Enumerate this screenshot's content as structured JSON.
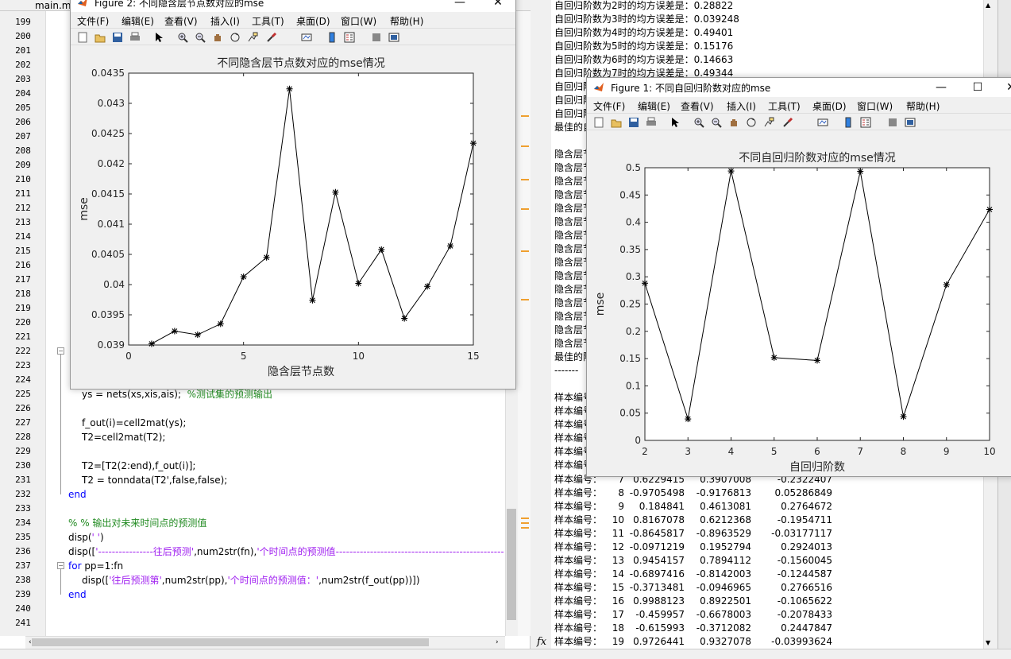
{
  "editor": {
    "tab_name": "main.m",
    "line_numbers": [
      "199",
      "200",
      "201",
      "202",
      "203",
      "204",
      "205",
      "206",
      "207",
      "208",
      "209",
      "210",
      "211",
      "212",
      "213",
      "214",
      "215",
      "216",
      "217",
      "218",
      "219",
      "220",
      "221",
      "222",
      "223",
      "224",
      "225",
      "226",
      "227",
      "228",
      "229",
      "230",
      "231",
      "232",
      "233",
      "234",
      "235",
      "236",
      "237",
      "238",
      "239",
      "240",
      "241"
    ],
    "code": {
      "l225_a": "ys = nets(xs,xis,ais);  ",
      "l225_c": "%测试集的预测输出",
      "l227": "f_out(i)=cell2mat(ys);",
      "l228": "T2=cell2mat(T2);",
      "l230": "T2=[T2(2:end),f_out(i)];",
      "l231": "T2 = tonndata(T2',false,false);",
      "l232": "end",
      "l234": "% % 输出对未来时间点的预测值",
      "l235_a": "disp(",
      "l235_s": "' '",
      "l235_b": ")",
      "l236_a": "disp([",
      "l236_s1": "'----------------往后预测'",
      "l236_b": ",num2str(fn),",
      "l236_s2": "'个时间点的预测值----------------------------------------------------'",
      "l237_k": "for",
      "l237_a": " pp=1:fn",
      "l238_a": "disp([",
      "l238_s1": "'往后预测第'",
      "l238_b": ",num2str(pp),",
      "l238_s2": "'个时间点的预测值：'",
      "l238_c": ",num2str(f_out(pp))])",
      "l239": "end"
    }
  },
  "command_window": {
    "top_lines": [
      "自回归阶数为2时的均方误差是：0.28822",
      "自回归阶数为3时的均方误差是：0.039248",
      "自回归阶数为4时的均方误差是：0.49401",
      "自回归阶数为5时的均方误差是：0.15176",
      "自回归阶数为6时的均方误差是：0.14663",
      "自回归阶数为7时的均方误差是：0.49344",
      "自回归阶",
      "自回归阶",
      "自回归阶",
      "最佳的自",
      "",
      "隐含层节",
      "隐含层节",
      "隐含层节",
      "隐含层节",
      "隐含层节",
      "隐含层节",
      "隐含层节",
      "隐含层节",
      "隐含层节",
      "隐含层节",
      "隐含层节",
      "隐含层节",
      "隐含层节",
      "隐含层节",
      "隐含层节",
      "最佳的隐",
      "-------",
      "",
      "样本编号",
      "样本编号",
      "样本编号",
      "样本编号",
      "样本编号",
      "样本编号"
    ],
    "sample_label": "样本编号：",
    "samples": [
      [
        "7",
        "0.6229415",
        "0.3907008",
        "-0.2322407"
      ],
      [
        "8",
        "-0.9705498",
        "-0.9176813",
        "0.05286849"
      ],
      [
        "9",
        "0.184841",
        "0.4613081",
        "0.2764672"
      ],
      [
        "10",
        "0.8167078",
        "0.6212368",
        "-0.1954711"
      ],
      [
        "11",
        "-0.8645817",
        "-0.8963529",
        "-0.03177117"
      ],
      [
        "12",
        "-0.0971219",
        "0.1952794",
        "0.2924013"
      ],
      [
        "13",
        "0.9454157",
        "0.7894112",
        "-0.1560045"
      ],
      [
        "14",
        "-0.6897416",
        "-0.8142003",
        "-0.1244587"
      ],
      [
        "15",
        "-0.3713481",
        "-0.0946965",
        "0.2766516"
      ],
      [
        "16",
        "0.9988123",
        "0.8922501",
        "-0.1065622"
      ],
      [
        "17",
        "-0.459957",
        "-0.6678003",
        "-0.2078433"
      ],
      [
        "18",
        "-0.615993",
        "-0.3712082",
        "0.2447847"
      ],
      [
        "19",
        "0.9726441",
        "0.9327078",
        "-0.03993624"
      ]
    ],
    "fx_label": "fx"
  },
  "figure2": {
    "title": "Figure 2: 不同隐含层节点数对应的mse",
    "menus": [
      "文件(F)",
      "编辑(E)",
      "查看(V)",
      "插入(I)",
      "工具(T)",
      "桌面(D)",
      "窗口(W)",
      "帮助(H)"
    ],
    "chart_data": {
      "type": "line",
      "title": "不同隐含层节点数对应的mse情况",
      "xlabel": "隐含层节点数",
      "ylabel": "mse",
      "xlim": [
        0,
        15
      ],
      "ylim": [
        0.039,
        0.0435
      ],
      "xticks": [
        "0",
        "5",
        "10",
        "15"
      ],
      "yticks": [
        "0.039",
        "0.0395",
        "0.04",
        "0.0405",
        "0.041",
        "0.0415",
        "0.042",
        "0.0425",
        "0.043",
        "0.0435"
      ],
      "x": [
        1,
        2,
        3,
        4,
        5,
        6,
        7,
        8,
        9,
        10,
        11,
        12,
        13,
        14,
        15
      ],
      "y": [
        0.03902,
        0.03923,
        0.03917,
        0.03935,
        0.04013,
        0.04045,
        0.04324,
        0.03974,
        0.04153,
        0.04002,
        0.04058,
        0.03944,
        0.03997,
        0.04064,
        0.04234
      ],
      "marker": "*",
      "line_color": "#000000"
    }
  },
  "figure1": {
    "title": "Figure 1: 不同自回归阶数对应的mse",
    "menus": [
      "文件(F)",
      "编辑(E)",
      "查看(V)",
      "插入(I)",
      "工具(T)",
      "桌面(D)",
      "窗口(W)",
      "帮助(H)"
    ],
    "chart_data": {
      "type": "line",
      "title": "不同自回归阶数对应的mse情况",
      "xlabel": "自回归阶数",
      "ylabel": "mse",
      "xlim": [
        2,
        10
      ],
      "ylim": [
        0,
        0.5
      ],
      "xticks": [
        "2",
        "3",
        "4",
        "5",
        "6",
        "7",
        "8",
        "9",
        "10"
      ],
      "yticks": [
        "0",
        "0.05",
        "0.1",
        "0.15",
        "0.2",
        "0.25",
        "0.3",
        "0.35",
        "0.4",
        "0.45",
        "0.5"
      ],
      "x": [
        2,
        3,
        4,
        5,
        6,
        7,
        8,
        9,
        10
      ],
      "y": [
        0.28822,
        0.039248,
        0.49401,
        0.15176,
        0.14663,
        0.49344,
        0.0435,
        0.2855,
        0.4235
      ],
      "marker": "*",
      "line_color": "#000000"
    }
  }
}
